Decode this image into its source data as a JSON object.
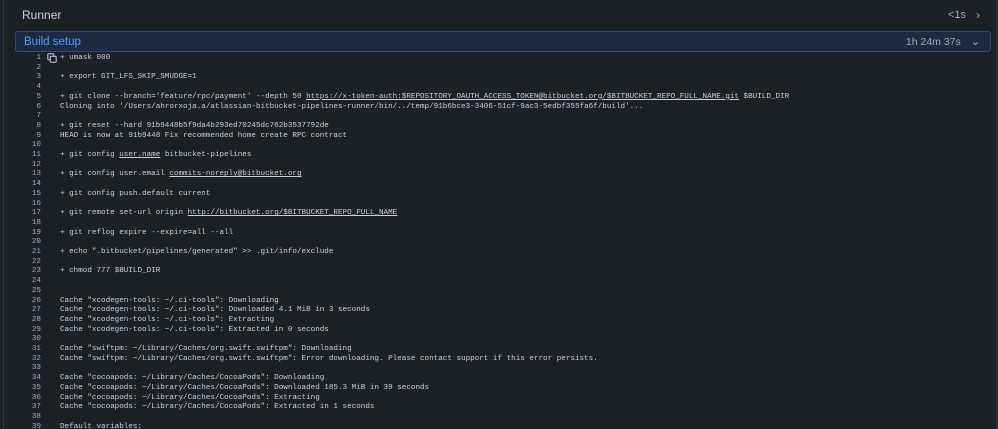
{
  "runner": {
    "title": "Runner",
    "duration": "<1s",
    "chevron": "chevron-right-icon"
  },
  "step": {
    "name": "Build setup",
    "duration": "1h 24m 37s",
    "chevron": "chevron-down-icon"
  },
  "log": [
    {
      "n": "1",
      "segs": [
        {
          "t": "+ umask 000"
        }
      ]
    },
    {
      "n": "2",
      "segs": []
    },
    {
      "n": "3",
      "segs": [
        {
          "t": "+ export GIT_LFS_SKIP_SMUDGE=1"
        }
      ]
    },
    {
      "n": "4",
      "segs": []
    },
    {
      "n": "5",
      "segs": [
        {
          "t": "+ git clone --branch='feature/rpc/payment' --depth 50 "
        },
        {
          "t": "https://x-token-auth:$REPOSITORY_OAUTH_ACCESS_TOKEN@bitbucket.org/$BITBUCKET_REPO_FULL_NAME.git",
          "link": true
        },
        {
          "t": " $BUILD_DIR"
        }
      ]
    },
    {
      "n": "6",
      "segs": [
        {
          "t": "Cloning into '/Users/ahrorxoja.a/atlassian-bitbucket-pipelines-runner/bin/../temp/91b6bce3-3406-51cf-9ac3-5edbf355fa6f/build'..."
        }
      ]
    },
    {
      "n": "7",
      "segs": []
    },
    {
      "n": "8",
      "segs": [
        {
          "t": "+ git reset --hard 91b9448b5f9da4b293ed70245dc762b3537792de"
        }
      ]
    },
    {
      "n": "9",
      "segs": [
        {
          "t": "HEAD is now at 91b9448 Fix recommended home create RPC contract"
        }
      ]
    },
    {
      "n": "10",
      "segs": []
    },
    {
      "n": "11",
      "segs": [
        {
          "t": "+ git config "
        },
        {
          "t": "user.name",
          "link": true
        },
        {
          "t": " bitbucket-pipelines"
        }
      ]
    },
    {
      "n": "12",
      "segs": []
    },
    {
      "n": "13",
      "segs": [
        {
          "t": "+ git config user.email "
        },
        {
          "t": "commits-noreply@bitbucket.org",
          "link": true
        }
      ]
    },
    {
      "n": "14",
      "segs": []
    },
    {
      "n": "15",
      "segs": [
        {
          "t": "+ git config push.default current"
        }
      ]
    },
    {
      "n": "16",
      "segs": []
    },
    {
      "n": "17",
      "segs": [
        {
          "t": "+ git remote set-url origin "
        },
        {
          "t": "http://bitbucket.org/$BITBUCKET_REPO_FULL_NAME",
          "link": true
        }
      ]
    },
    {
      "n": "18",
      "segs": []
    },
    {
      "n": "19",
      "segs": [
        {
          "t": "+ git reflog expire --expire=all --all"
        }
      ]
    },
    {
      "n": "20",
      "segs": []
    },
    {
      "n": "21",
      "segs": [
        {
          "t": "+ echo \".bitbucket/pipelines/generated\" >> .git/info/exclude"
        }
      ]
    },
    {
      "n": "22",
      "segs": []
    },
    {
      "n": "23",
      "segs": [
        {
          "t": "+ chmod 777 $BUILD_DIR"
        }
      ]
    },
    {
      "n": "24",
      "segs": []
    },
    {
      "n": "25",
      "segs": []
    },
    {
      "n": "26",
      "segs": [
        {
          "t": "Cache \"xcodegen-tools: ~/.ci-tools\": Downloading"
        }
      ]
    },
    {
      "n": "27",
      "segs": [
        {
          "t": "Cache \"xcodegen-tools: ~/.ci-tools\": Downloaded 4.1 MiB in 3 seconds"
        }
      ]
    },
    {
      "n": "28",
      "segs": [
        {
          "t": "Cache \"xcodegen-tools: ~/.ci-tools\": Extracting"
        }
      ]
    },
    {
      "n": "29",
      "segs": [
        {
          "t": "Cache \"xcodegen-tools: ~/.ci-tools\": Extracted in 0 seconds"
        }
      ]
    },
    {
      "n": "30",
      "segs": []
    },
    {
      "n": "31",
      "segs": [
        {
          "t": "Cache \"swiftpm: ~/Library/Caches/org.swift.swiftpm\": Downloading"
        }
      ]
    },
    {
      "n": "32",
      "segs": [
        {
          "t": "Cache \"swiftpm: ~/Library/Caches/org.swift.swiftpm\": Error downloading. Please contact support if this error persists."
        }
      ]
    },
    {
      "n": "33",
      "segs": []
    },
    {
      "n": "34",
      "segs": [
        {
          "t": "Cache \"cocoapods: ~/Library/Caches/CocoaPods\": Downloading"
        }
      ]
    },
    {
      "n": "35",
      "segs": [
        {
          "t": "Cache \"cocoapods: ~/Library/Caches/CocoaPods\": Downloaded 185.3 MiB in 39 seconds"
        }
      ]
    },
    {
      "n": "36",
      "segs": [
        {
          "t": "Cache \"cocoapods: ~/Library/Caches/CocoaPods\": Extracting"
        }
      ]
    },
    {
      "n": "37",
      "segs": [
        {
          "t": "Cache \"cocoapods: ~/Library/Caches/CocoaPods\": Extracted in 1 seconds"
        }
      ]
    },
    {
      "n": "38",
      "segs": []
    },
    {
      "n": "39",
      "segs": [
        {
          "t": "Default variables:"
        }
      ]
    }
  ]
}
